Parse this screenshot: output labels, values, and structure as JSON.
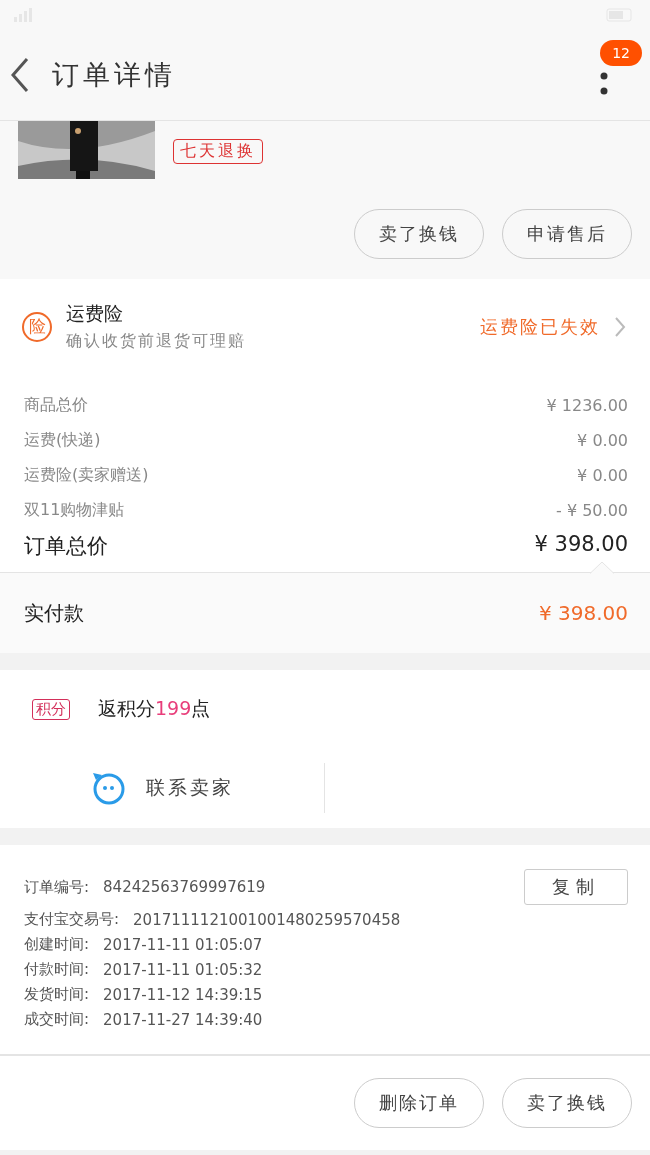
{
  "header": {
    "title": "订单详情",
    "badge": "12"
  },
  "product": {
    "tag": "七天退换",
    "buttons": [
      "卖了换钱",
      "申请售后"
    ]
  },
  "insurance": {
    "icon_label": "险",
    "title": "运费险",
    "subtitle": "确认收货前退货可理赔",
    "status": "运费险已失效"
  },
  "price_rows": [
    {
      "label": "商品总价",
      "value": "¥ 1236.00"
    },
    {
      "label": "运费(快递)",
      "value": "¥ 0.00"
    },
    {
      "label": "运费险(卖家赠送)",
      "value": "¥ 0.00"
    },
    {
      "label": "双11购物津贴",
      "value": "- ¥ 50.00"
    }
  ],
  "order_total": {
    "label": "订单总价",
    "value": "¥ 398.00"
  },
  "paid": {
    "label": "实付款",
    "value": "¥ 398.00"
  },
  "points": {
    "badge": "积分",
    "prefix": "返积分",
    "amount": "199",
    "suffix": "点"
  },
  "contact": {
    "label": "联系卖家"
  },
  "order_info": {
    "order_no": {
      "label": "订单编号:",
      "value": "84242563769997619"
    },
    "copy_button": "复制",
    "rows": [
      {
        "label": "支付宝交易号:",
        "value": "2017111121001001480259570458"
      },
      {
        "label": "创建时间:",
        "value": "2017-11-11 01:05:07"
      },
      {
        "label": "付款时间:",
        "value": "2017-11-11 01:05:32"
      },
      {
        "label": "发货时间:",
        "value": "2017-11-12 14:39:15"
      },
      {
        "label": "成交时间:",
        "value": "2017-11-27 14:39:40"
      }
    ]
  },
  "actions": [
    "删除订单",
    "卖了换钱"
  ]
}
